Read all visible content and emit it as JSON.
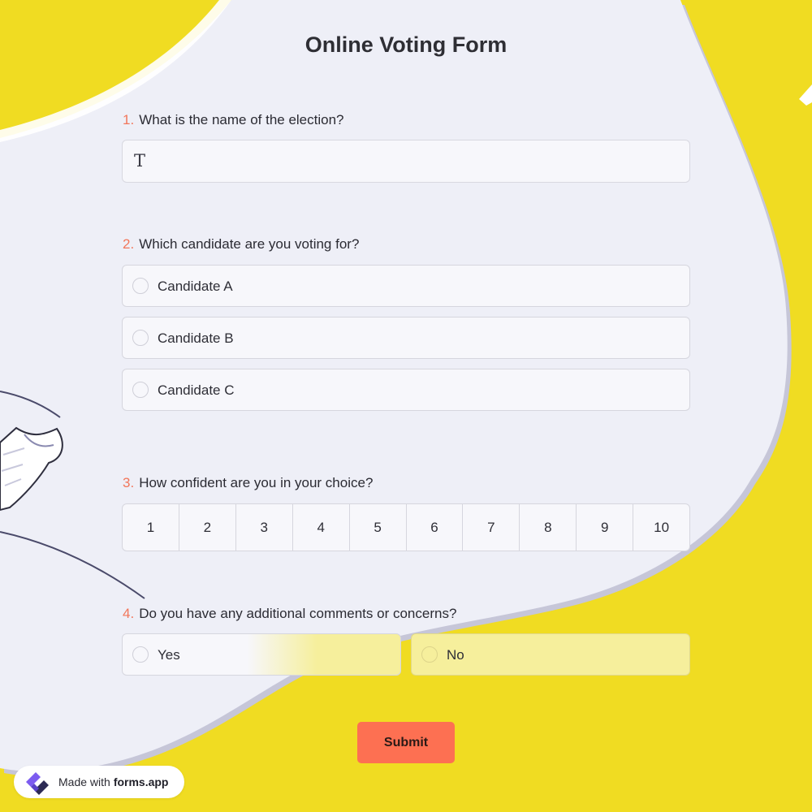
{
  "form": {
    "title": "Online Voting Form"
  },
  "questions": [
    {
      "number": "1.",
      "label": "What is the name of the election?",
      "type": "text",
      "value": ""
    },
    {
      "number": "2.",
      "label": "Which candidate are you voting for?",
      "type": "radio",
      "options": [
        "Candidate A",
        "Candidate B",
        "Candidate C"
      ]
    },
    {
      "number": "3.",
      "label": "How confident are you in your choice?",
      "type": "scale",
      "options": [
        "1",
        "2",
        "3",
        "4",
        "5",
        "6",
        "7",
        "8",
        "9",
        "10"
      ]
    },
    {
      "number": "4.",
      "label": "Do you have any additional comments or concerns?",
      "type": "radio",
      "options": [
        "Yes",
        "No"
      ]
    }
  ],
  "icons": {
    "text_field": "T",
    "text_field_icon_name": "text-type-icon",
    "logo_name": "forms-app-logo-icon"
  },
  "submit": {
    "label": "Submit"
  },
  "badge": {
    "made_with": "Made with",
    "brand": "forms.app"
  },
  "colors": {
    "background": "#f0dc22",
    "panel": "#eeeff7",
    "accent_number": "#f2765a",
    "submit": "#fd7052"
  }
}
